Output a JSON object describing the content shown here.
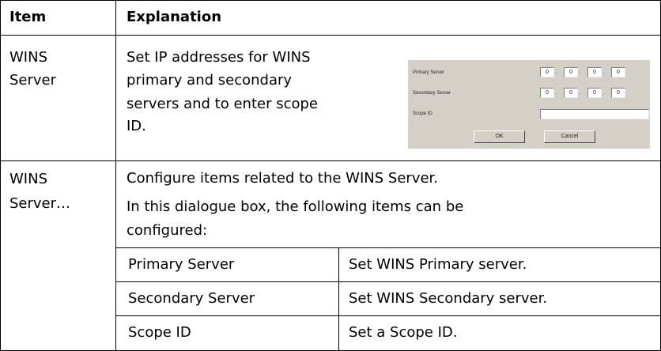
{
  "header": {
    "item": "Item",
    "explanation": "Explanation"
  },
  "rows": [
    {
      "item": [
        "WINS",
        "Server"
      ],
      "explanation": [
        "Set IP addresses for WINS",
        "primary and secondary",
        "servers and to enter scope",
        "ID."
      ],
      "dialog": {
        "primary_label": "Primary Server",
        "secondary_label": "Secondary Server",
        "scope_label": "Scope ID",
        "primary_octets": [
          "0",
          "0",
          "0",
          "0"
        ],
        "secondary_octets": [
          "0",
          "0",
          "0",
          "0"
        ],
        "scope_value": "",
        "ok": "OK",
        "cancel": "Cancel"
      }
    },
    {
      "item": [
        "WINS",
        "Server…"
      ],
      "explanation": [
        "Configure items related to the WINS Server.",
        "In this dialogue box, the following items can be",
        "configured:"
      ],
      "subtable": [
        {
          "name": "Primary Server",
          "desc": "Set WINS Primary server."
        },
        {
          "name": "Secondary Server",
          "desc": "Set WINS Secondary server."
        },
        {
          "name": "Scope ID",
          "desc": "Set a Scope ID."
        }
      ]
    }
  ]
}
